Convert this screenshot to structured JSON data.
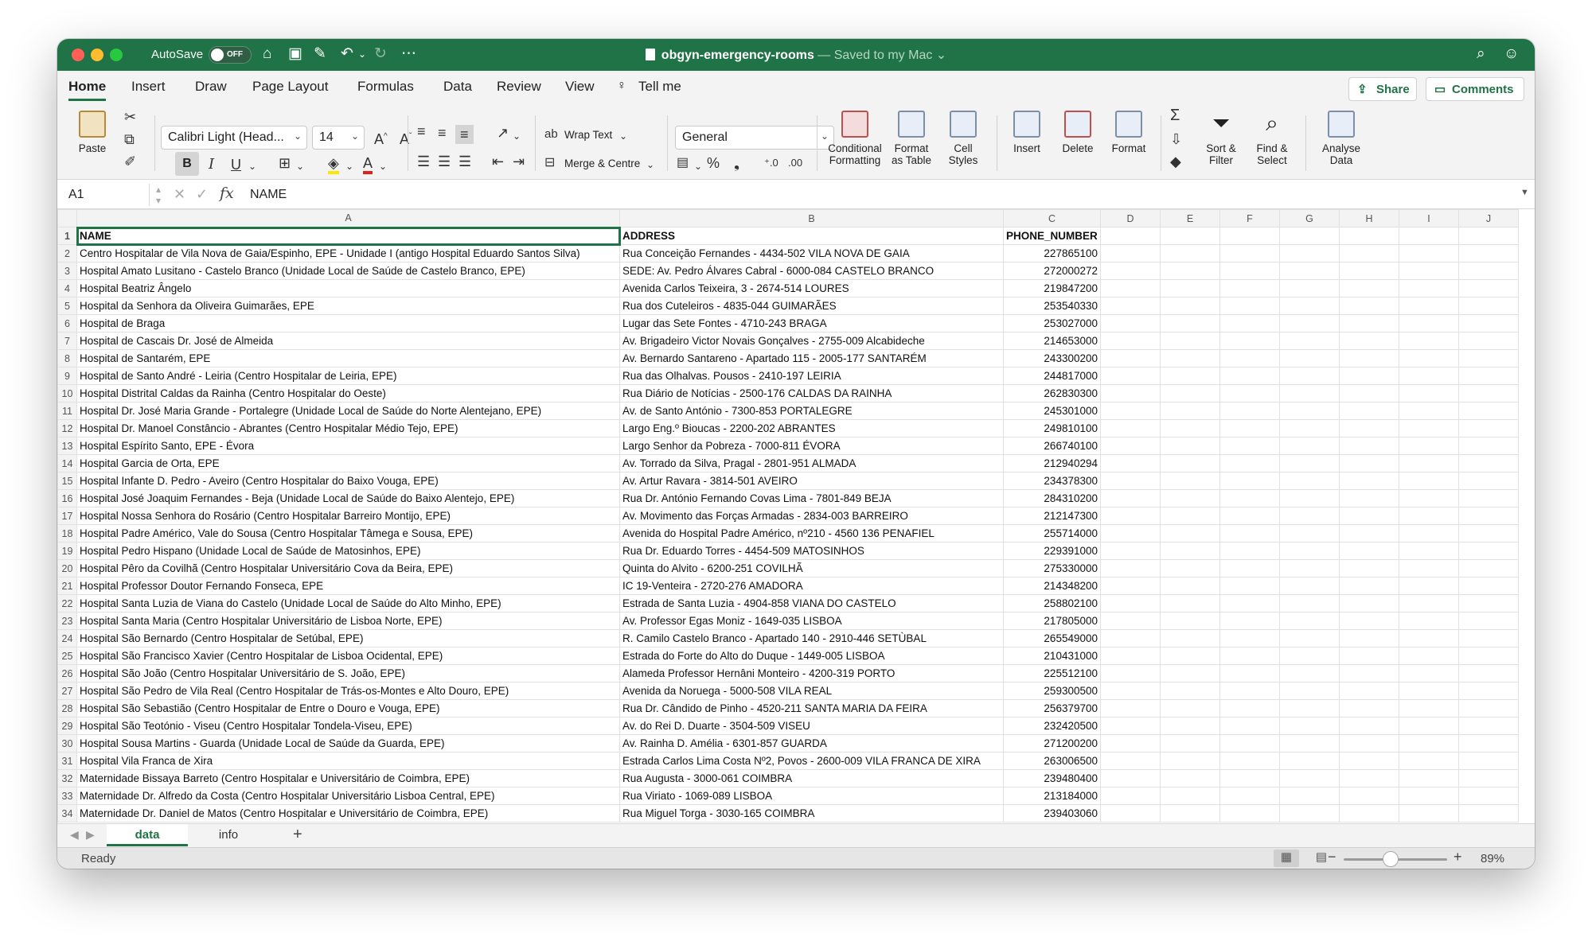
{
  "title_bar": {
    "autosave_label": "AutoSave",
    "autosave_state": "OFF",
    "file_name": "obgyn-emergency-rooms",
    "save_status": " — Saved to my Mac ⌄"
  },
  "ribbon_tabs": [
    "Home",
    "Insert",
    "Draw",
    "Page Layout",
    "Formulas",
    "Data",
    "Review",
    "View",
    "Tell me"
  ],
  "share_label": "Share",
  "comments_label": "Comments",
  "ribbon": {
    "paste": "Paste",
    "font_name": "Calibri Light (Head...",
    "font_size": "14",
    "bold": "B",
    "italic": "I",
    "underline": "U",
    "wrap_text": "Wrap Text",
    "merge_centre": "Merge & Centre",
    "number_format": "General",
    "conditional_formatting": "Conditional Formatting",
    "format_as_table": "Format as Table",
    "cell_styles": "Cell Styles",
    "insert": "Insert",
    "delete": "Delete",
    "format": "Format",
    "sort_filter": "Sort & Filter",
    "find_select": "Find & Select",
    "analyse_data": "Analyse Data",
    "percent": "%"
  },
  "formula_bar": {
    "cell_ref": "A1",
    "fx": "fx",
    "content": "NAME"
  },
  "columns": [
    "A",
    "B",
    "C",
    "D",
    "E",
    "F",
    "G",
    "H",
    "I",
    "J"
  ],
  "header_row": [
    "NAME",
    "ADDRESS",
    "PHONE_NUMBER"
  ],
  "rows": [
    [
      "Centro Hospitalar de Vila Nova de Gaia/Espinho, EPE - Unidade I (antigo Hospital Eduardo Santos Silva)",
      "Rua Conceição Fernandes - 4434-502 VILA NOVA DE GAIA",
      "227865100"
    ],
    [
      "Hospital Amato Lusitano - Castelo Branco (Unidade Local de Saúde de Castelo Branco, EPE)",
      "SEDE: Av. Pedro Álvares Cabral - 6000-084 CASTELO BRANCO",
      "272000272"
    ],
    [
      "Hospital Beatriz Ângelo",
      "Avenida Carlos Teixeira, 3 - 2674-514 LOURES",
      "219847200"
    ],
    [
      "Hospital da Senhora da Oliveira Guimarães, EPE",
      "Rua dos Cuteleiros - 4835-044 GUIMARÃES",
      "253540330"
    ],
    [
      "Hospital de Braga",
      "Lugar das Sete Fontes - 4710-243 BRAGA",
      "253027000"
    ],
    [
      "Hospital de Cascais Dr. José de Almeida",
      "Av. Brigadeiro Victor Novais Gonçalves - 2755-009 Alcabideche",
      "214653000"
    ],
    [
      "Hospital de Santarém, EPE",
      "Av. Bernardo Santareno - Apartado 115 - 2005-177 SANTARÉM",
      "243300200"
    ],
    [
      "Hospital de Santo André - Leiria (Centro Hospitalar de Leiria, EPE)",
      "Rua das Olhalvas. Pousos - 2410-197 LEIRIA",
      "244817000"
    ],
    [
      "Hospital Distrital Caldas da Rainha (Centro Hospitalar do Oeste)",
      "Rua Diário de Notícias - 2500-176 CALDAS DA RAINHA",
      "262830300"
    ],
    [
      "Hospital Dr. José Maria Grande - Portalegre (Unidade Local de Saúde do Norte Alentejano, EPE)",
      "Av. de Santo António - 7300-853 PORTALEGRE",
      "245301000"
    ],
    [
      "Hospital Dr. Manoel Constâncio - Abrantes (Centro Hospitalar Médio Tejo, EPE)",
      "Largo Eng.º Bioucas - 2200-202 ABRANTES",
      "249810100"
    ],
    [
      "Hospital Espírito Santo, EPE - Évora",
      "Largo Senhor da Pobreza - 7000-811 ÉVORA",
      "266740100"
    ],
    [
      "Hospital Garcia de Orta, EPE",
      "Av. Torrado da Silva, Pragal - 2801-951 ALMADA",
      "212940294"
    ],
    [
      "Hospital Infante D. Pedro - Aveiro (Centro Hospitalar do Baixo Vouga, EPE)",
      "Av. Artur Ravara - 3814-501 AVEIRO",
      "234378300"
    ],
    [
      "Hospital José Joaquim Fernandes - Beja (Unidade Local de Saúde do Baixo Alentejo, EPE)",
      "Rua Dr. António Fernando Covas Lima - 7801-849 BEJA",
      "284310200"
    ],
    [
      "Hospital Nossa Senhora do Rosário (Centro Hospitalar Barreiro Montijo, EPE)",
      "Av. Movimento das Forças Armadas - 2834-003 BARREIRO",
      "212147300"
    ],
    [
      "Hospital Padre Américo, Vale do Sousa (Centro Hospitalar Tâmega e Sousa, EPE)",
      "Avenida do Hospital Padre Américo, nº210 - 4560 136 PENAFIEL",
      "255714000"
    ],
    [
      "Hospital Pedro Hispano (Unidade Local de Saúde de Matosinhos, EPE)",
      "Rua Dr. Eduardo Torres - 4454-509 MATOSINHOS",
      "229391000"
    ],
    [
      "Hospital Pêro da Covilhã (Centro Hospitalar Universitário Cova da Beira, EPE)",
      "Quinta do Alvito - 6200-251 COVILHÃ",
      "275330000"
    ],
    [
      "Hospital Professor Doutor Fernando Fonseca, EPE",
      "IC 19-Venteira - 2720-276 AMADORA",
      "214348200"
    ],
    [
      "Hospital Santa Luzia de Viana do Castelo (Unidade Local de Saúde do Alto Minho, EPE)",
      "Estrada de Santa Luzia - 4904-858 VIANA DO CASTELO",
      "258802100"
    ],
    [
      "Hospital Santa Maria (Centro Hospitalar Universitário de Lisboa Norte, EPE)",
      "Av. Professor Egas Moniz - 1649-035 LISBOA",
      "217805000"
    ],
    [
      "Hospital São Bernardo (Centro Hospitalar de Setúbal, EPE)",
      "R. Camilo Castelo Branco - Apartado 140 - 2910-446 SETÙBAL",
      "265549000"
    ],
    [
      "Hospital São Francisco Xavier (Centro Hospitalar de Lisboa Ocidental, EPE)",
      "Estrada do Forte do Alto do Duque - 1449-005 LISBOA",
      "210431000"
    ],
    [
      "Hospital São João (Centro Hospitalar Universitário de S. João, EPE)",
      "Alameda Professor Hernâni Monteiro - 4200-319 PORTO",
      "225512100"
    ],
    [
      "Hospital São Pedro de Vila Real (Centro Hospitalar de Trás-os-Montes e Alto Douro, EPE)",
      "Avenida da Noruega - 5000-508 VILA REAL",
      "259300500"
    ],
    [
      "Hospital São Sebastião (Centro Hospitalar de Entre o Douro e Vouga, EPE)",
      "Rua Dr. Cândido de Pinho - 4520-211 SANTA MARIA DA FEIRA",
      "256379700"
    ],
    [
      "Hospital São Teotónio - Viseu (Centro Hospitalar Tondela-Viseu, EPE)",
      "Av. do Rei D. Duarte - 3504-509 VISEU",
      "232420500"
    ],
    [
      "Hospital Sousa Martins - Guarda (Unidade Local de Saúde da Guarda, EPE)",
      "Av. Rainha D. Amélia - 6301-857 GUARDA",
      "271200200"
    ],
    [
      "Hospital Vila Franca de Xira",
      "Estrada Carlos Lima Costa Nº2, Povos - 2600-009  VILA FRANCA DE XIRA",
      "263006500"
    ],
    [
      "Maternidade Bissaya Barreto (Centro Hospitalar e Universitário de Coimbra, EPE)",
      "Rua Augusta - 3000-061 COIMBRA",
      "239480400"
    ],
    [
      "Maternidade Dr. Alfredo da Costa (Centro Hospitalar Universitário Lisboa Central, EPE)",
      " Rua Viriato - 1069-089 LISBOA",
      "213184000"
    ],
    [
      "Maternidade Dr. Daniel de Matos (Centro Hospitalar e Universitário de Coimbra, EPE)",
      "Rua Miguel Torga - 3030-165 COIMBRA",
      "239403060"
    ]
  ],
  "sheet_tabs": [
    "data",
    "info"
  ],
  "add_sheet": "+",
  "status": {
    "ready": "Ready",
    "zoom": "89%",
    "zoom_fraction": 0.45
  }
}
